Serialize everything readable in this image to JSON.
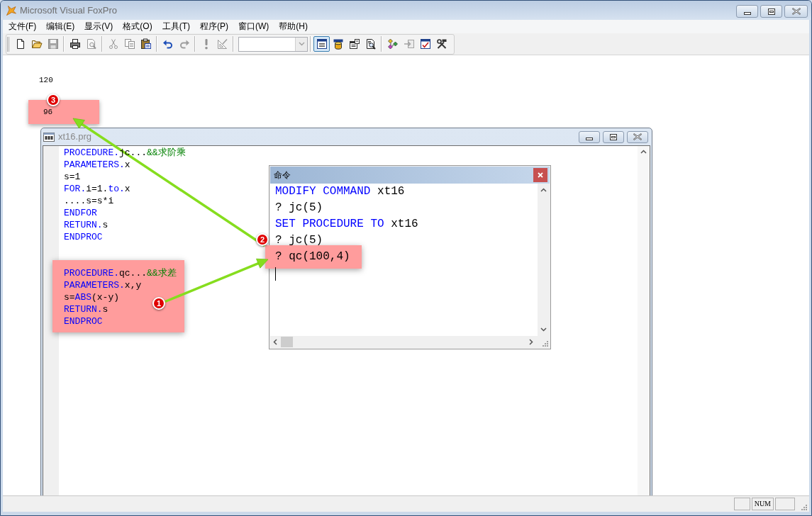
{
  "window": {
    "title": "Microsoft Visual FoxPro"
  },
  "menu": [
    "文件(F)",
    "编辑(E)",
    "显示(V)",
    "格式(O)",
    "工具(T)",
    "程序(P)",
    "窗口(W)",
    "帮助(H)"
  ],
  "toolbar": [
    {
      "kind": "button",
      "disabled": false,
      "pressed": false
    },
    {
      "kind": "button",
      "disabled": false,
      "pressed": false
    },
    {
      "kind": "button",
      "disabled": true,
      "pressed": false
    },
    {
      "kind": "separator"
    },
    {
      "kind": "button",
      "disabled": false,
      "pressed": false
    },
    {
      "kind": "button",
      "disabled": true,
      "pressed": false
    },
    {
      "kind": "separator"
    },
    {
      "kind": "button",
      "disabled": true,
      "pressed": false
    },
    {
      "kind": "button",
      "disabled": true,
      "pressed": false
    },
    {
      "kind": "button",
      "disabled": false,
      "pressed": false
    },
    {
      "kind": "separator"
    },
    {
      "kind": "button",
      "disabled": false,
      "pressed": false
    },
    {
      "kind": "button",
      "disabled": true,
      "pressed": false
    },
    {
      "kind": "separator"
    },
    {
      "kind": "button",
      "disabled": true,
      "pressed": false
    },
    {
      "kind": "button",
      "disabled": true,
      "pressed": false
    },
    {
      "kind": "separator"
    },
    {
      "kind": "combo",
      "disabled": true
    },
    {
      "kind": "separator"
    },
    {
      "kind": "button",
      "disabled": false,
      "pressed": true
    },
    {
      "kind": "button",
      "disabled": false,
      "pressed": false
    },
    {
      "kind": "button",
      "disabled": false,
      "pressed": false
    },
    {
      "kind": "button",
      "disabled": false,
      "pressed": false
    },
    {
      "kind": "separator"
    },
    {
      "kind": "button",
      "disabled": false,
      "pressed": false
    },
    {
      "kind": "button",
      "disabled": true,
      "pressed": false
    },
    {
      "kind": "button",
      "disabled": false,
      "pressed": false
    },
    {
      "kind": "button",
      "disabled": false,
      "pressed": false
    }
  ],
  "screen_output": [
    {
      "text": "120",
      "highlighted": false
    },
    {
      "text": "96",
      "highlighted": true
    }
  ],
  "code_window": {
    "title": "xt16.prg",
    "blocks": [
      {
        "highlighted": false,
        "lines": [
          [
            {
              "text": "PROCEDURE.",
              "kind": "keyword"
            },
            {
              "text": "jc...",
              "kind": "plain"
            },
            {
              "text": "&&求阶乘",
              "kind": "comment"
            }
          ],
          [
            {
              "text": "PARAMETERS.",
              "kind": "keyword"
            },
            {
              "text": "x",
              "kind": "plain"
            }
          ],
          [
            {
              "text": "s=1",
              "kind": "plain"
            }
          ],
          [
            {
              "text": "FOR.",
              "kind": "keyword"
            },
            {
              "text": "i=1.",
              "kind": "plain"
            },
            {
              "text": "to.",
              "kind": "keyword"
            },
            {
              "text": "x",
              "kind": "plain"
            }
          ],
          [
            {
              "text": "....s=s*i",
              "kind": "plain"
            }
          ],
          [
            {
              "text": "ENDFOR",
              "kind": "keyword"
            }
          ],
          [
            {
              "text": "RETURN.",
              "kind": "keyword"
            },
            {
              "text": "s",
              "kind": "plain"
            }
          ],
          [
            {
              "text": "ENDPROC",
              "kind": "keyword"
            }
          ]
        ]
      },
      {
        "highlighted": true,
        "lines": [
          [
            {
              "text": "PROCEDURE.",
              "kind": "keyword"
            },
            {
              "text": "qc...",
              "kind": "plain"
            },
            {
              "text": "&&求差",
              "kind": "comment"
            }
          ],
          [
            {
              "text": "PARAMETERS.",
              "kind": "keyword"
            },
            {
              "text": "x,y",
              "kind": "plain"
            }
          ],
          [
            {
              "text": "s=",
              "kind": "plain"
            },
            {
              "text": "ABS",
              "kind": "keyword"
            },
            {
              "text": "(x-y)",
              "kind": "plain"
            }
          ],
          [
            {
              "text": "RETURN.",
              "kind": "keyword"
            },
            {
              "text": "s",
              "kind": "plain"
            }
          ],
          [
            {
              "text": "ENDPROC",
              "kind": "keyword"
            }
          ]
        ]
      }
    ]
  },
  "command_window": {
    "title": "命令",
    "lines": [
      {
        "highlighted": false,
        "segments": [
          {
            "text": "MODIFY COMMAND",
            "kind": "keyword"
          },
          {
            "text": " xt16",
            "kind": "plain"
          }
        ]
      },
      {
        "highlighted": false,
        "segments": [
          {
            "text": "? jc(5)",
            "kind": "plain"
          }
        ]
      },
      {
        "highlighted": false,
        "segments": [
          {
            "text": "SET PROCEDURE TO",
            "kind": "keyword"
          },
          {
            "text": " xt16",
            "kind": "plain"
          }
        ]
      },
      {
        "highlighted": false,
        "segments": [
          {
            "text": "? jc(5)",
            "kind": "plain"
          }
        ]
      },
      {
        "highlighted": true,
        "segments": [
          {
            "text": "? qc(100,4)",
            "kind": "plain"
          }
        ]
      }
    ],
    "cursor": true
  },
  "callouts": [
    {
      "label": "1"
    },
    {
      "label": "2"
    },
    {
      "label": "3"
    }
  ],
  "status_bar": {
    "indicators": [
      "NUM"
    ]
  }
}
